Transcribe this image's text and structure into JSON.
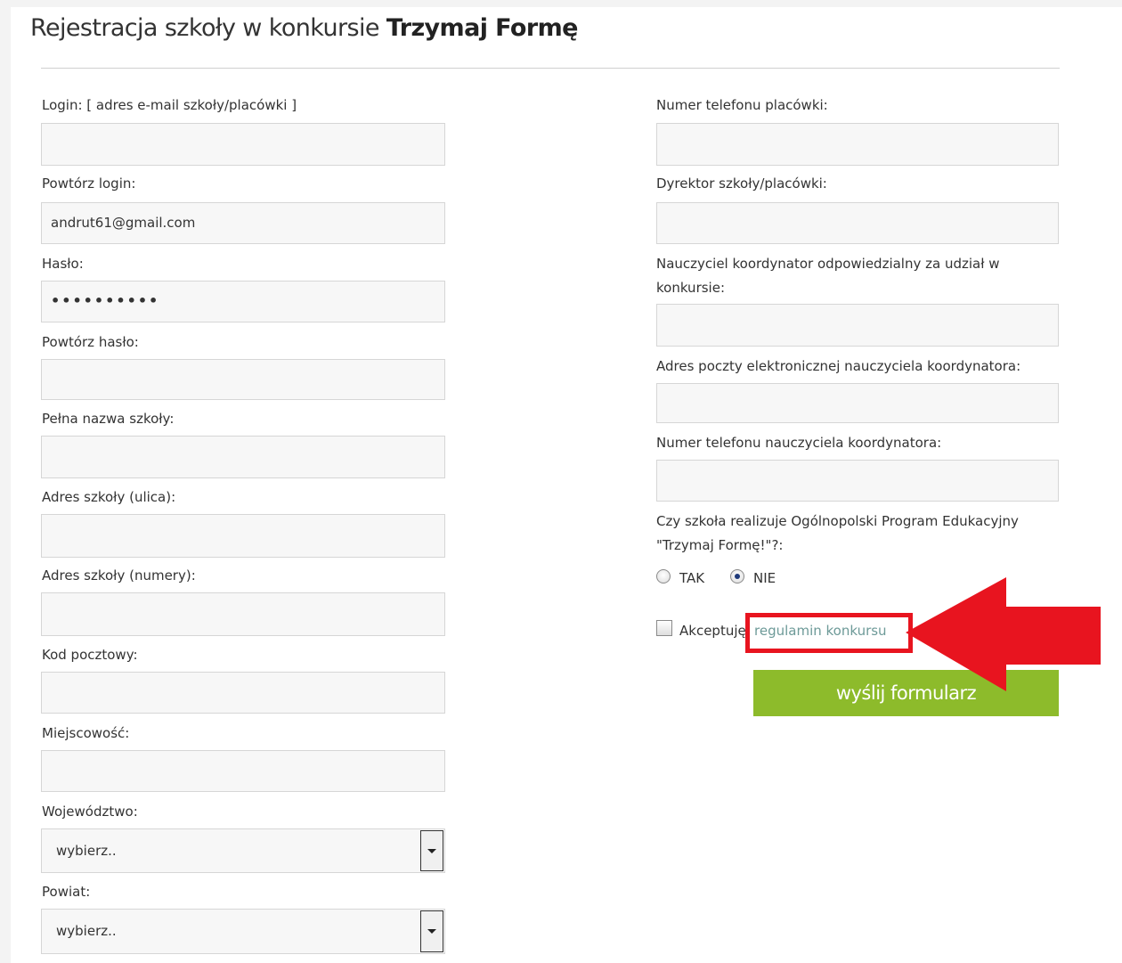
{
  "page": {
    "title_prefix": "Rejestracja szkoły w konkursie ",
    "title_bold": "Trzymaj Formę"
  },
  "left_fields": {
    "login_label": "Login: [ adres e-mail szkoły/placówki ]",
    "login_value": "",
    "repeat_login_label": "Powtórz login:",
    "repeat_login_value": "andrut61@gmail.com",
    "password_label": "Hasło:",
    "password_value": "••••••••••",
    "repeat_password_label": "Powtórz hasło:",
    "repeat_password_value": "",
    "school_name_label": "Pełna nazwa szkoły:",
    "school_name_value": "",
    "street_label": "Adres szkoły (ulica):",
    "street_value": "",
    "numbers_label": "Adres szkoły (numery):",
    "numbers_value": "",
    "postal_code_label": "Kod pocztowy:",
    "postal_code_value": "",
    "city_label": "Miejscowość:",
    "city_value": "",
    "voivodeship_label": "Województwo:",
    "voivodeship_selected": "wybierz..",
    "county_label": "Powiat:",
    "county_selected": "wybierz.."
  },
  "right_fields": {
    "school_phone_label": "Numer telefonu placówki:",
    "school_phone_value": "",
    "director_label": "Dyrektor szkoły/placówki:",
    "director_value": "",
    "coordinator_label": "Nauczyciel koordynator odpowiedzialny za udział w konkursie:",
    "coordinator_value": "",
    "coordinator_email_label": "Adres poczty elektronicznej nauczyciela koordynatora:",
    "coordinator_email_value": "",
    "coordinator_phone_label": "Numer telefonu nauczyciela koordynatora:",
    "coordinator_phone_value": "",
    "program_question": "Czy szkoła realizuje Ogólnopolski Program Edukacyjny \"Trzymaj Formę!\"?:",
    "option_yes": "TAK",
    "option_no": "NIE",
    "program_selected": "NIE"
  },
  "terms": {
    "accept_label": "Akceptuję",
    "accept_checked": false,
    "link_text": "regulamin konkursu"
  },
  "submit_label": "wyślij formularz",
  "colors": {
    "submit_bg": "#8dbb2b",
    "link": "#6d9a98",
    "annotation_red": "#e8141f"
  }
}
